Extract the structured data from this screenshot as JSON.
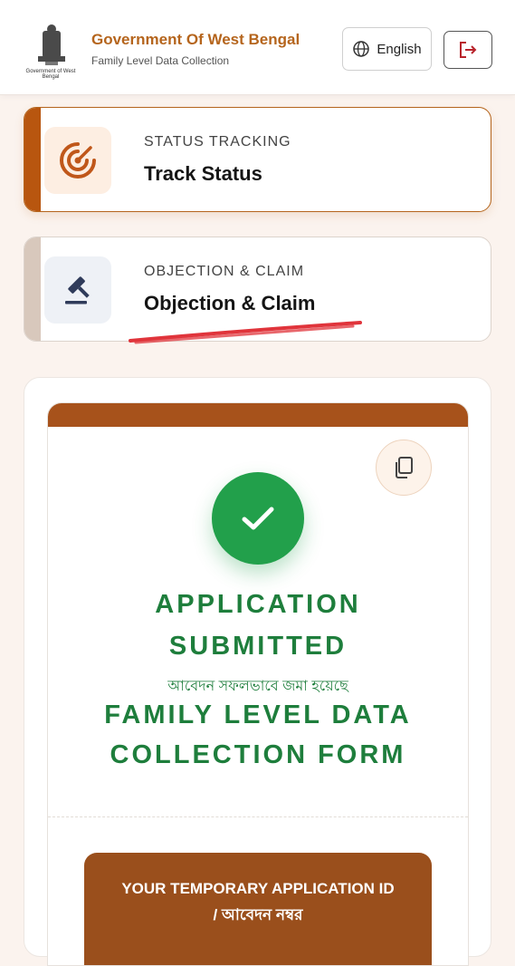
{
  "header": {
    "emblem_caption": "Government of West Bengal",
    "title": "Government Of West Bengal",
    "subtitle": "Family Level Data Collection",
    "language_label": "English"
  },
  "cards": [
    {
      "kicker": "STATUS TRACKING",
      "heading": "Track Status",
      "icon": "radar-icon"
    },
    {
      "kicker": "OBJECTION & CLAIM",
      "heading": "Objection & Claim",
      "icon": "gavel-icon"
    }
  ],
  "success": {
    "title_line1": "APPLICATION",
    "title_line2": "SUBMITTED",
    "bengali_message": "আবেদন সফলভাবে জমা হয়েছে",
    "form_line1": "FAMILY LEVEL DATA",
    "form_line2": "COLLECTION FORM",
    "id_label_line1": "YOUR TEMPORARY APPLICATION ID",
    "id_label_line2": "/  আবেদন নম্বর"
  },
  "colors": {
    "brand_orange": "#b5651d",
    "accent_brown": "#a7521b",
    "success_green": "#22a04b",
    "heading_green": "#1e7e3c",
    "scribble_red": "#e0343b"
  }
}
